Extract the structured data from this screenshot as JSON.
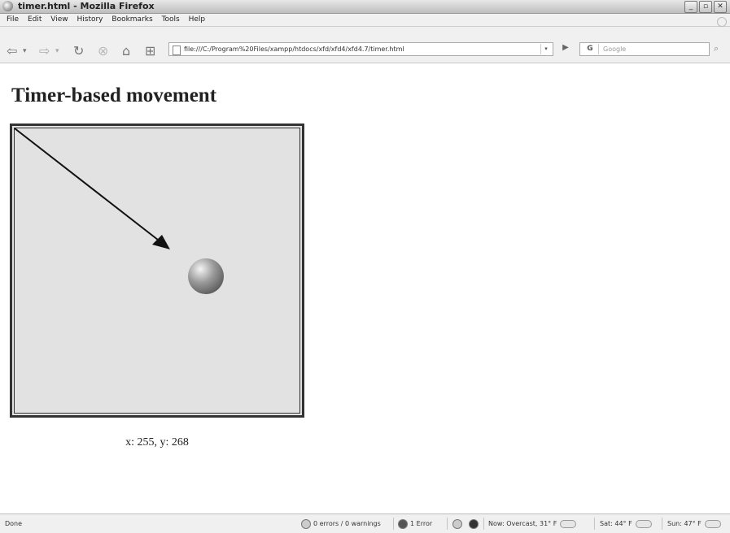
{
  "window": {
    "title": "timer.html - Mozilla Firefox"
  },
  "menu": {
    "items": [
      "File",
      "Edit",
      "View",
      "History",
      "Bookmarks",
      "Tools",
      "Help"
    ]
  },
  "toolbar": {
    "back_icon": "back-arrow-icon",
    "forward_icon": "forward-arrow-icon",
    "reload_icon": "reload-icon",
    "stop_icon": "stop-icon",
    "home_icon": "home-icon",
    "newtab_icon": "new-tab-icon",
    "url": "file:///C:/Program%20Files/xampp/htdocs/xfd/xfd4/xfd4.7/timer.html",
    "search_placeholder": "Google",
    "search_engine": "G"
  },
  "page": {
    "title": "Timer-based movement",
    "coords_text": "x: 255, y: 268"
  },
  "status": {
    "done": "Done",
    "errors": "0 errors / 0 warnings",
    "error_count": "1 Error",
    "weather_now": "Now: Overcast, 31° F",
    "weather_sat": "Sat: 44° F",
    "weather_sun": "Sun: 47° F"
  },
  "colors": {
    "canvas_bg": "#e2e2e2",
    "border": "#333333"
  }
}
